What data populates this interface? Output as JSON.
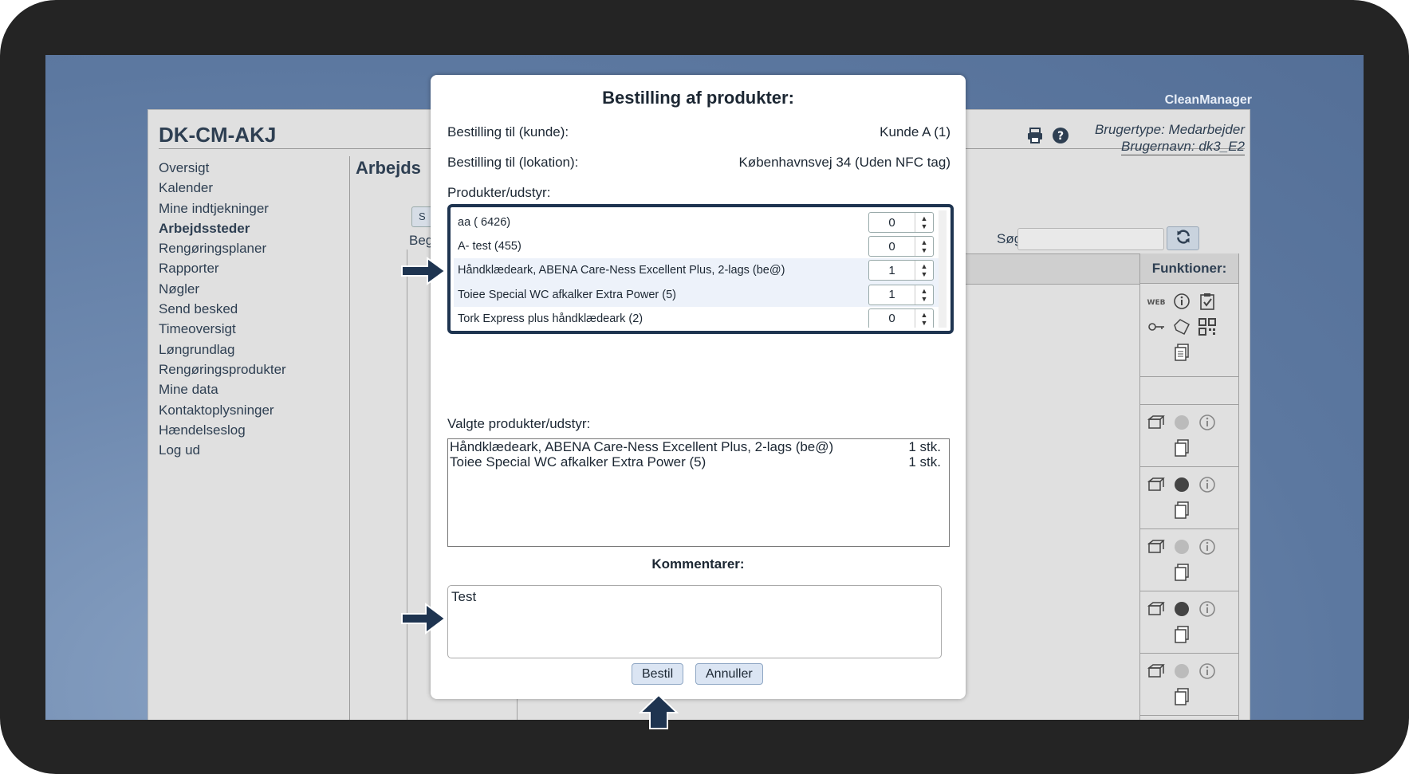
{
  "brand": "CleanManager",
  "app": {
    "title": "DK-CM-AKJ",
    "user_type": "Brugertype: Medarbejder",
    "user_name": "Brugernavn: dk3_E2",
    "page_heading": "Arbejds",
    "left_button_partial": "S",
    "beg_label": "Beg",
    "search_label": "Søg:",
    "functions_header": "Funktioner:",
    "icons": [
      "print-icon",
      "help-icon",
      "refresh-icon",
      "web-icon",
      "info-icon",
      "clipboard-check-icon",
      "key-icon",
      "tag-icon",
      "qr-code-icon",
      "documents-icon",
      "box-icon",
      "globe-icon"
    ]
  },
  "nav": {
    "items": [
      "Oversigt",
      "Kalender",
      "Mine indtjekninger",
      "Arbejdssteder",
      "Rengøringsplaner",
      "Rapporter",
      "Nøgler",
      "Send besked",
      "Timeoversigt",
      "Løngrundlag",
      "Rengøringsprodukter",
      "Mine data",
      "Kontaktoplysninger",
      "Hændelseslog",
      "Log ud"
    ],
    "active": "Arbejdssteder"
  },
  "modal": {
    "title": "Bestilling af produkter:",
    "customer_label": "Bestilling til (kunde):",
    "customer_value": "Kunde A (1)",
    "location_label": "Bestilling til (lokation):",
    "location_value": "Københavnsvej 34 (Uden NFC tag)",
    "products_label": "Produkter/udstyr:",
    "products": [
      {
        "name": "aa ( 6426)",
        "qty": "0"
      },
      {
        "name": "A- test (455)",
        "qty": "0"
      },
      {
        "name": "Håndklædeark, ABENA Care-Ness Excellent Plus, 2-lags (be@)",
        "qty": "1"
      },
      {
        "name": "Toiee Special WC afkalker Extra Power (5)",
        "qty": "1"
      },
      {
        "name": "Tork Express plus håndklædeark (2)",
        "qty": "0"
      }
    ],
    "selected_label": "Valgte produkter/udstyr:",
    "selected": [
      {
        "name": "Håndklædeark, ABENA Care-Ness Excellent Plus, 2-lags (be@)",
        "qty": "1 stk."
      },
      {
        "name": "Toiee Special WC afkalker Extra Power (5)",
        "qty": "1 stk."
      }
    ],
    "comments_label": "Kommentarer:",
    "comment_value": "Test",
    "order_button": "Bestil",
    "cancel_button": "Annuller"
  },
  "colors": {
    "frame": "#242424",
    "desktop": "#5c78a0",
    "accent": "#1e3450",
    "button": "#dbe5f3"
  }
}
